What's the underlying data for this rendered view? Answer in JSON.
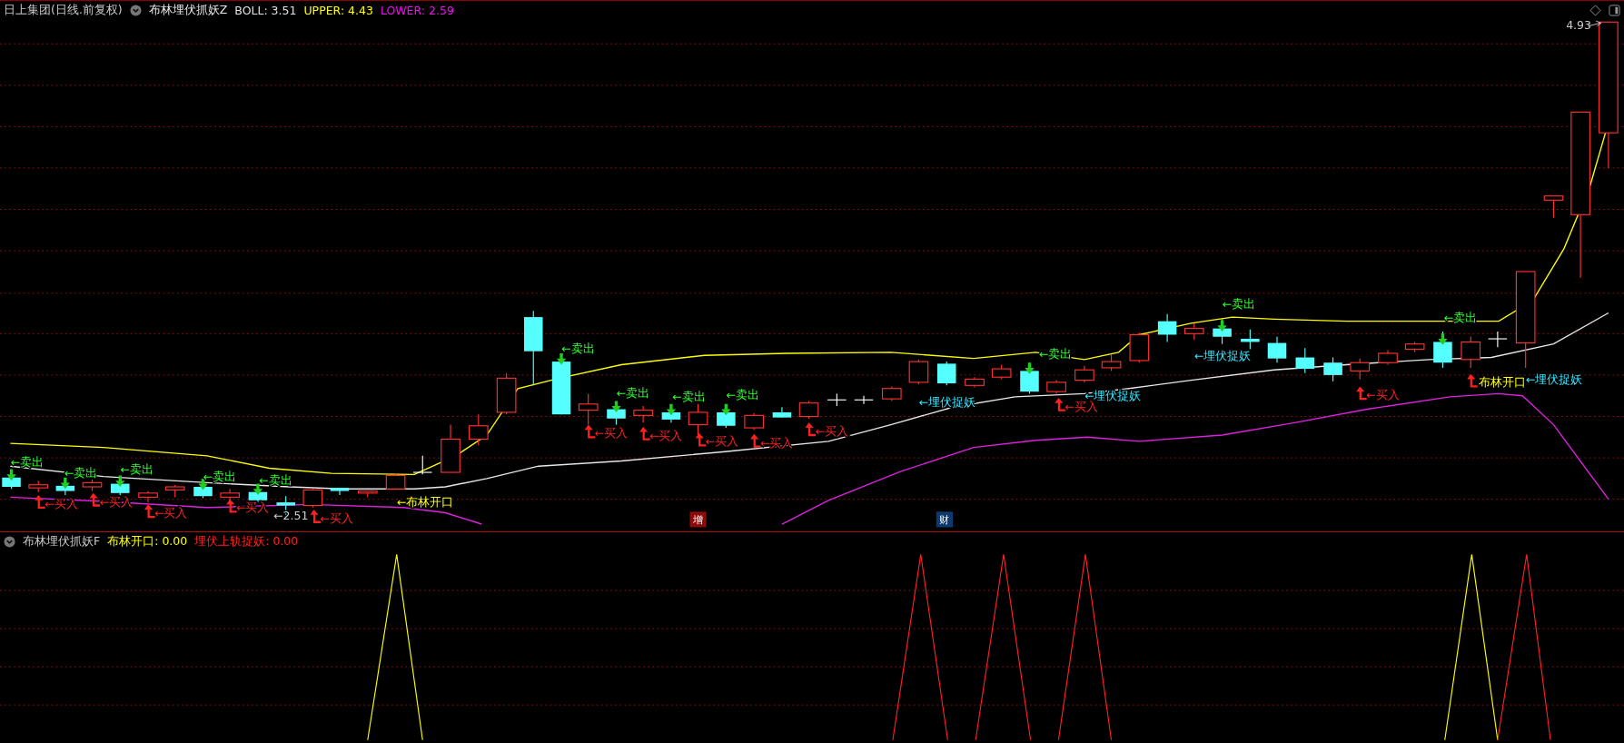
{
  "main_panel": {
    "header": {
      "security": "日上集团(日线.前复权)",
      "indicator": "布林埋伏抓妖Z",
      "values": [
        {
          "text": "BOLL: 3.51",
          "color": "#e0e0e0"
        },
        {
          "text": "UPPER: 4.43",
          "color": "#ffff00"
        },
        {
          "text": "LOWER: 2.59",
          "color": "#ff00ff"
        }
      ]
    },
    "high_label": "4.93",
    "signals": [
      {
        "kind": "sell",
        "text": "←卖出"
      },
      {
        "kind": "buy",
        "text": "←买入"
      },
      {
        "kind": "sell",
        "text": "←卖出"
      },
      {
        "kind": "buy",
        "text": "←买入"
      },
      {
        "kind": "sell",
        "text": "←卖出"
      },
      {
        "kind": "buy",
        "text": "←买入"
      },
      {
        "kind": "sell",
        "text": "←卖出"
      },
      {
        "kind": "buy",
        "text": "←买入"
      },
      {
        "kind": "sell",
        "text": "←卖出"
      },
      {
        "kind": "low",
        "text": "←2.51"
      },
      {
        "kind": "buy",
        "text": "←买入"
      },
      {
        "kind": "open",
        "text": "←布林开口"
      },
      {
        "kind": "sell",
        "text": "←卖出"
      },
      {
        "kind": "buy",
        "text": "←买入"
      },
      {
        "kind": "sell",
        "text": "←卖出"
      },
      {
        "kind": "buy",
        "text": "←买入"
      },
      {
        "kind": "sell",
        "text": "←卖出"
      },
      {
        "kind": "buy",
        "text": "←买入"
      },
      {
        "kind": "sell",
        "text": "←卖出"
      },
      {
        "kind": "buy",
        "text": "←买入"
      },
      {
        "kind": "buy",
        "text": "←买入"
      },
      {
        "kind": "ambush",
        "text": "←埋伏捉妖"
      },
      {
        "kind": "sell",
        "text": "←卖出"
      },
      {
        "kind": "buy",
        "text": "←买入"
      },
      {
        "kind": "ambush",
        "text": "←埋伏捉妖"
      },
      {
        "kind": "ambush",
        "text": "←埋伏捉妖"
      },
      {
        "kind": "sell",
        "text": "←卖出"
      },
      {
        "kind": "buy",
        "text": "←买入"
      },
      {
        "kind": "sell",
        "text": "←卖出"
      },
      {
        "kind": "buy"
      },
      {
        "kind": "open",
        "text": "布林开口"
      },
      {
        "kind": "ambush",
        "text": "←埋伏捉妖"
      }
    ],
    "badges": [
      {
        "text": "增",
        "color": "#8b0a0a"
      },
      {
        "text": "财",
        "color": "#0c3a6e"
      }
    ]
  },
  "sub_panel": {
    "header": {
      "indicator": "布林埋伏抓妖F",
      "values": [
        {
          "text": "布林开口: 0.00",
          "color": "#ffff00"
        },
        {
          "text": "埋伏上轨捉妖: 0.00",
          "color": "#ff2020"
        }
      ]
    }
  }
}
